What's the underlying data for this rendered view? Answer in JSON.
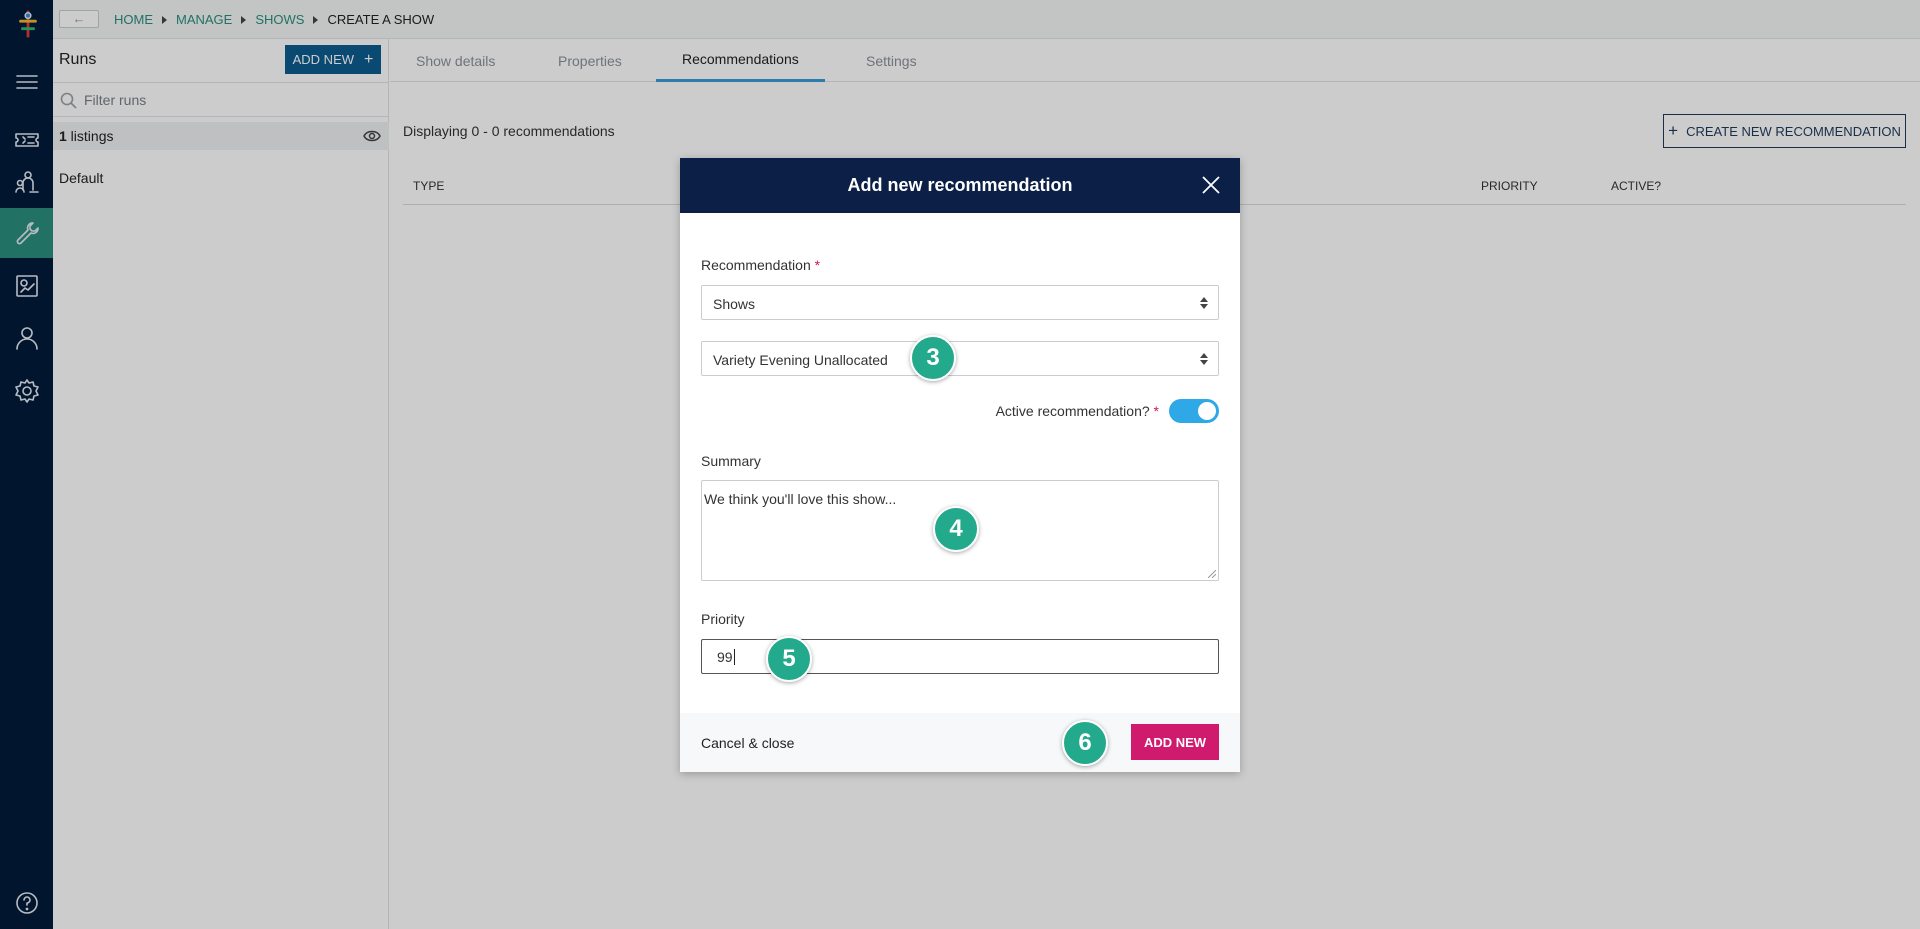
{
  "colors": {
    "rail": "#031b3a",
    "accent_green": "#2a8f7e",
    "modal_header": "#0b1f47",
    "primary_blue": "#0d5d8f",
    "pink": "#cf1a6e",
    "toggle": "#2fa8e7",
    "step_badge": "#23a98b"
  },
  "topbar": {
    "back_icon": "←",
    "breadcrumbs": [
      "HOME",
      "MANAGE",
      "SHOWS",
      "CREATE A SHOW"
    ]
  },
  "rail": {
    "icons": [
      "logo",
      "menu-icon",
      "ticket-icon",
      "audience-icon",
      "wrench-icon",
      "report-icon",
      "user-icon",
      "gear-icon",
      "help-icon"
    ],
    "active": "wrench-icon"
  },
  "runs": {
    "title": "Runs",
    "add_new_label": "ADD NEW",
    "add_new_icon": "+",
    "filter_placeholder": "Filter runs",
    "listings_count": "1",
    "listings_label": " listings",
    "items": [
      "Default"
    ]
  },
  "main": {
    "tabs": [
      "Show details",
      "Properties",
      "Recommendations",
      "Settings"
    ],
    "active_tab": "Recommendations",
    "displaying_text": "Displaying 0 - 0 recommendations",
    "create_button": "CREATE NEW RECOMMENDATION",
    "create_icon": "+",
    "columns": [
      "TYPE",
      "PRIORITY",
      "ACTIVE?"
    ]
  },
  "modal": {
    "title": "Add new recommendation",
    "recommendation_label": "Recommendation",
    "required_mark": "*",
    "recommendation_type": "Shows",
    "recommendation_item": "Variety Evening Unallocated",
    "active_label": "Active recommendation?",
    "active": true,
    "summary_label": "Summary",
    "summary_value": "We think you'll love this show...",
    "priority_label": "Priority",
    "priority_value": "99",
    "cancel_label": "Cancel & close",
    "submit_label": "ADD NEW"
  },
  "steps": [
    "3",
    "4",
    "5",
    "6"
  ]
}
